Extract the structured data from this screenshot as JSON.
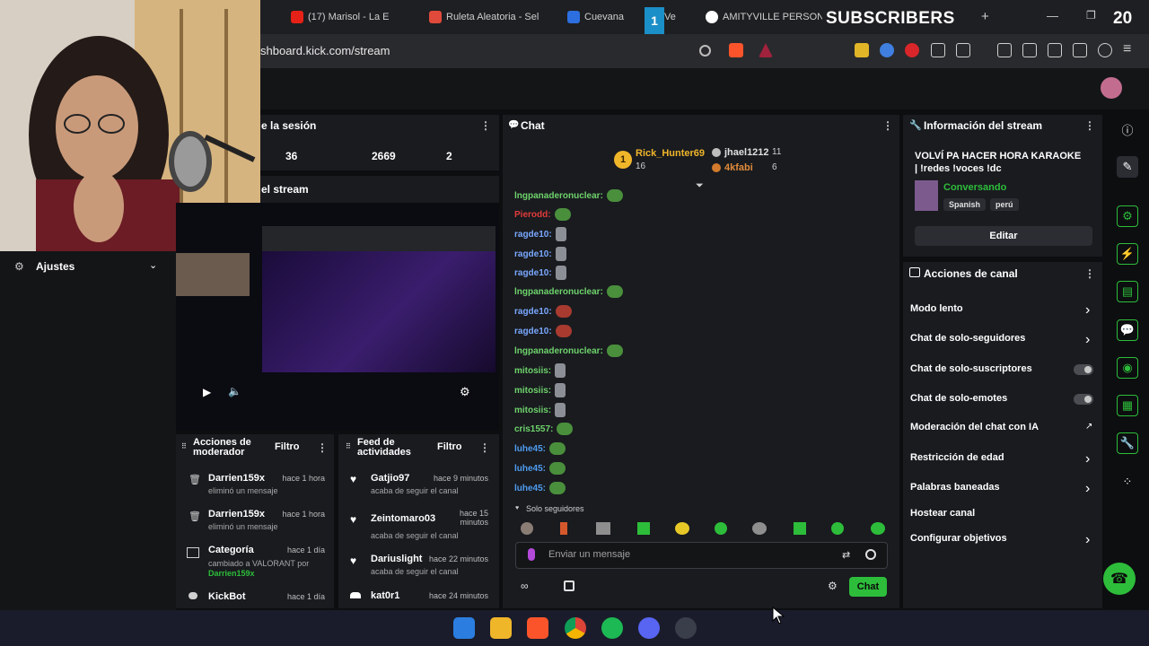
{
  "browser": {
    "tabs": [
      {
        "label": "(17) Marisol - La E",
        "color": "#e62117"
      },
      {
        "label": "Ruleta Aleatoria - Sel",
        "color": "#e04a3b"
      },
      {
        "label": "Cuevana",
        "color": "#2d6fe0"
      },
      {
        "label": "Ve",
        "color": "#2d6fe0"
      },
      {
        "label": "AMITYVILLE PERSON",
        "color": "#ffffff"
      }
    ],
    "url": "shboard.kick.com/stream",
    "overlay_label": "SUBSCRIBERS",
    "overlay_count": "20",
    "overlay_badge": "1"
  },
  "left_panel": {
    "settings_label": "Ajustes"
  },
  "session_panel": {
    "title": "e la sesión",
    "stats": [
      "36",
      "2669",
      "2"
    ]
  },
  "stream_preview": {
    "title": "el stream"
  },
  "chat": {
    "title": "Chat",
    "top_chatters": [
      {
        "name": "Rick_Hunter69",
        "count": "16"
      },
      {
        "name": "jhael1212",
        "count": "11"
      },
      {
        "name": "4kfabi",
        "count": "6"
      }
    ],
    "top_rank": "1",
    "messages": [
      {
        "user": "lngpanaderonuclear:",
        "color": "#6ed36b",
        "emote": "green"
      },
      {
        "user": "Pierodd:",
        "color": "#e33b3b",
        "emote": "green"
      },
      {
        "user": "ragde10:",
        "color": "#7aa8ff",
        "emote": "gray"
      },
      {
        "user": "ragde10:",
        "color": "#7aa8ff",
        "emote": "gray"
      },
      {
        "user": "ragde10:",
        "color": "#7aa8ff",
        "emote": "gray"
      },
      {
        "user": "lngpanaderonuclear:",
        "color": "#6ed36b",
        "emote": "green"
      },
      {
        "user": "ragde10:",
        "color": "#7aa8ff",
        "emote": "red"
      },
      {
        "user": "ragde10:",
        "color": "#7aa8ff",
        "emote": "red"
      },
      {
        "user": "lngpanaderonuclear:",
        "color": "#6ed36b",
        "emote": "green"
      },
      {
        "user": "mitosiis:",
        "color": "#6ed36b",
        "emote": "gray"
      },
      {
        "user": "mitosiis:",
        "color": "#6ed36b",
        "emote": "gray"
      },
      {
        "user": "mitosiis:",
        "color": "#6ed36b",
        "emote": "gray"
      },
      {
        "user": "cris1557:",
        "color": "#6ed36b",
        "emote": "green"
      },
      {
        "user": "luhe45:",
        "color": "#4f9cf0",
        "emote": "green"
      },
      {
        "user": "luhe45:",
        "color": "#4f9cf0",
        "emote": "green"
      },
      {
        "user": "luhe45:",
        "color": "#4f9cf0",
        "emote": "green"
      }
    ],
    "followers_only": "Solo seguidores",
    "input_placeholder": "Enviar un mensaje",
    "send_label": "Chat"
  },
  "mod_actions": {
    "title_line1": "Acciones de",
    "title_line2": "moderador",
    "filter": "Filtro",
    "items": [
      {
        "name": "Darrien159x",
        "time": "hace 1 hora",
        "desc": "eliminó un mensaje",
        "desc2": ""
      },
      {
        "name": "Darrien159x",
        "time": "hace 1 hora",
        "desc": "eliminó un mensaje",
        "desc2": ""
      },
      {
        "name": "Categoría",
        "time": "hace 1 día",
        "desc": "cambiado a VALORANT por",
        "desc2": "Darrien159x"
      },
      {
        "name": "KickBot",
        "time": "hace 1 día",
        "desc": "",
        "desc2": ""
      }
    ]
  },
  "activity_feed": {
    "title_line1": "Feed de",
    "title_line2": "actividades",
    "filter": "Filtro",
    "items": [
      {
        "name": "Gatjio97",
        "time": "hace 9 minutos",
        "desc": "acaba de seguir el canal"
      },
      {
        "name": "Zeintomaro03",
        "time": "hace 15 minutos",
        "desc": "acaba de seguir el canal"
      },
      {
        "name": "Dariuslight",
        "time": "hace 22 minutos",
        "desc": "acaba de seguir el canal"
      },
      {
        "name": "kat0r1",
        "time": "hace 24 minutos",
        "desc": ""
      }
    ]
  },
  "stream_info": {
    "title": "Información del stream",
    "stream_title": "VOLVÍ PA HACER HORA KARAOKE | !redes !voces !dc",
    "category": "Conversando",
    "tags": [
      "Spanish",
      "perú"
    ],
    "edit_label": "Editar"
  },
  "channel_actions": {
    "title": "Acciones de canal",
    "items": [
      {
        "label": "Modo lento",
        "control": "chevron"
      },
      {
        "label": "Chat de solo-seguidores",
        "control": "chevron"
      },
      {
        "label": "Chat de solo-suscriptores",
        "control": "toggle"
      },
      {
        "label": "Chat de solo-emotes",
        "control": "toggle"
      },
      {
        "label": "Moderación del chat con IA",
        "control": "external"
      },
      {
        "label": "Restricción de edad",
        "control": "chevron"
      },
      {
        "label": "Palabras baneadas",
        "control": "chevron"
      },
      {
        "label": "Hostear canal",
        "control": "none"
      },
      {
        "label": "Configurar objetivos",
        "control": "chevron"
      }
    ]
  },
  "colors": {
    "kick_green": "#2dbd3a",
    "panel_bg": "#191b1f",
    "page_bg": "#0d0e10"
  }
}
